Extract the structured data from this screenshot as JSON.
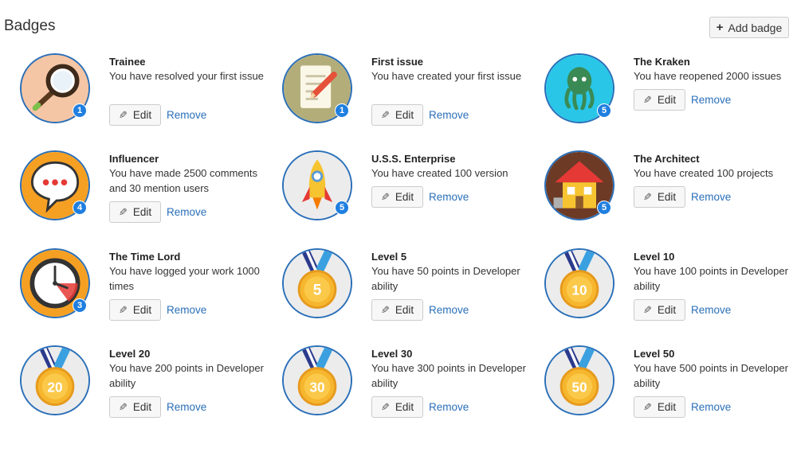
{
  "page": {
    "title": "Badges"
  },
  "toolbar": {
    "add_label": "Add badge",
    "add_icon": "plus-icon"
  },
  "actions": {
    "edit_label": "Edit",
    "remove_label": "Remove",
    "edit_icon": "pencil-icon"
  },
  "colors": {
    "accent": "#2a6fb8",
    "count_badge": "#1f7fe0"
  },
  "badges": [
    {
      "name": "Trainee",
      "desc": "You have resolved your first issue",
      "count": "1",
      "icon": "magnifier-icon"
    },
    {
      "name": "First issue",
      "desc": "You have created your first issue",
      "count": "1",
      "icon": "document-pencil-icon"
    },
    {
      "name": "The Kraken",
      "desc": "You have reopened 2000 issues",
      "count": "5",
      "icon": "octopus-icon"
    },
    {
      "name": "Influencer",
      "desc": "You have made 2500 comments and 30 mention users",
      "count": "4",
      "icon": "speech-bubble-icon"
    },
    {
      "name": "U.S.S. Enterprise",
      "desc": "You have created 100 version",
      "count": "5",
      "icon": "rocket-icon"
    },
    {
      "name": "The Architect",
      "desc": "You have created 100 projects",
      "count": "5",
      "icon": "house-icon"
    },
    {
      "name": "The Time Lord",
      "desc": "You have logged your work 1000 times",
      "count": "3",
      "icon": "clock-icon"
    },
    {
      "name": "Level 5",
      "desc": "You have 50 points in Developer ability",
      "medal": "5",
      "icon": "medal-icon"
    },
    {
      "name": "Level 10",
      "desc": "You have 100 points in Developer ability",
      "medal": "10",
      "icon": "medal-icon"
    },
    {
      "name": "Level 20",
      "desc": "You have 200 points in Developer ability",
      "medal": "20",
      "icon": "medal-icon"
    },
    {
      "name": "Level 30",
      "desc": "You have 300 points in Developer ability",
      "medal": "30",
      "icon": "medal-icon"
    },
    {
      "name": "Level 50",
      "desc": "You have 500 points in Developer ability",
      "medal": "50",
      "icon": "medal-icon"
    }
  ]
}
